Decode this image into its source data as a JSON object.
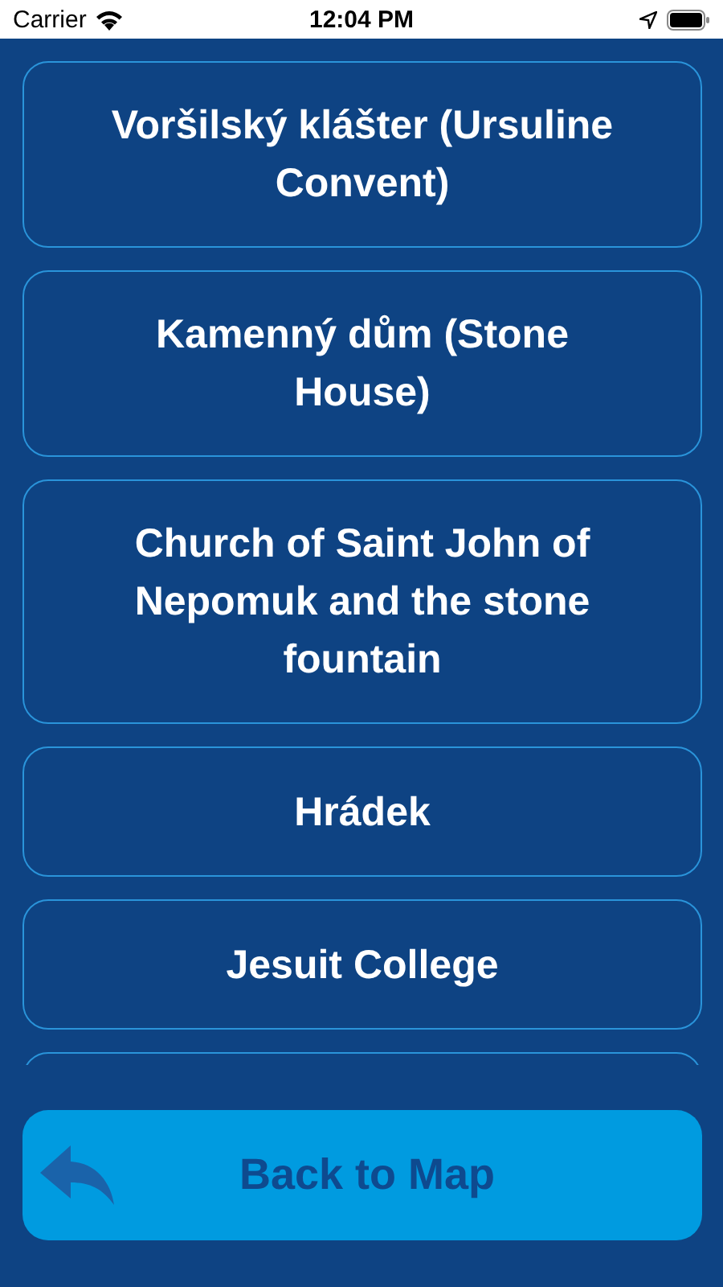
{
  "status_bar": {
    "carrier": "Carrier",
    "time": "12:04 PM"
  },
  "places": [
    {
      "kind": "labeled",
      "name": "Voršilský klášter (Ursuline Convent)"
    },
    {
      "kind": "labeled",
      "name": "Kamenný dům (Stone House)"
    },
    {
      "kind": "labeled",
      "name": "Church of Saint John of Nepomuk and the stone fountain"
    },
    {
      "kind": "labeled",
      "name": "Hrádek"
    },
    {
      "kind": "labeled",
      "name": "Jesuit College"
    },
    {
      "kind": "cut_off"
    }
  ],
  "back_button": {
    "label": "Back to Map"
  }
}
